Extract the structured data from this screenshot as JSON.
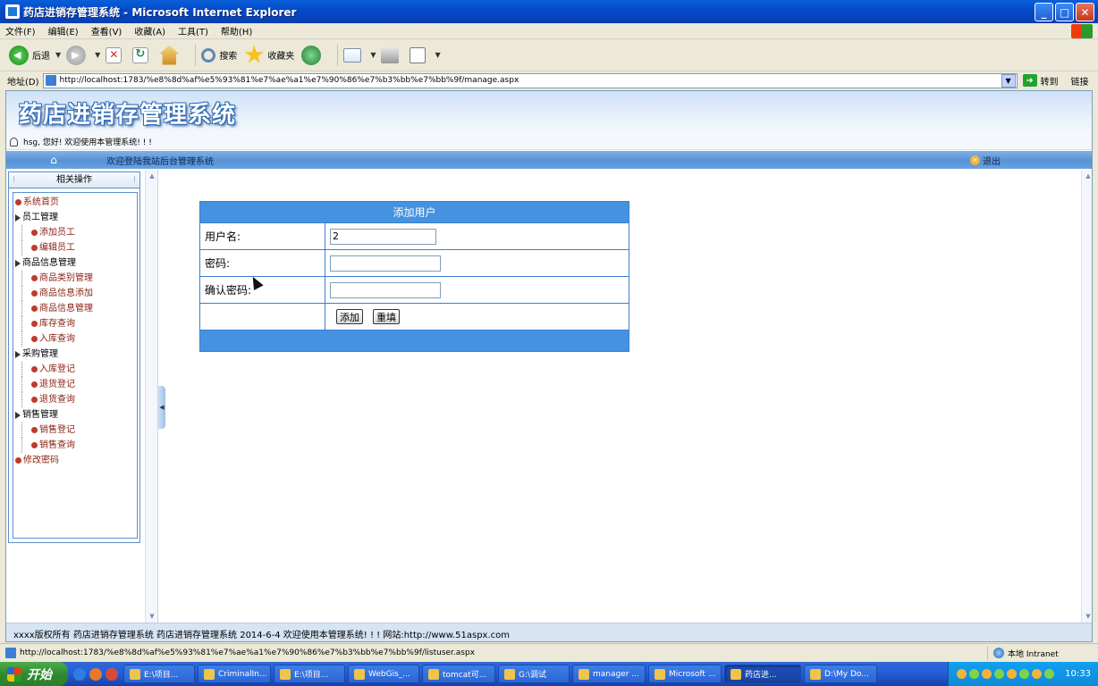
{
  "window": {
    "title": "药店进销存管理系统 - Microsoft Internet Explorer",
    "min": "_",
    "max": "□",
    "close": "✕"
  },
  "menubar": [
    "文件(F)",
    "编辑(E)",
    "查看(V)",
    "收藏(A)",
    "工具(T)",
    "帮助(H)"
  ],
  "toolbar": {
    "back": "后退",
    "search": "搜索",
    "favorites": "收藏夹"
  },
  "address": {
    "label": "地址(D)",
    "url": "http://localhost:1783/%e8%8d%af%e5%93%81%e7%ae%a1%e7%90%86%e7%b3%bb%e7%bb%9f/manage.aspx",
    "go": "转到",
    "links": "链接"
  },
  "site": {
    "logo": "药店进销存管理系统",
    "greeting": "hsg, 您好! 欢迎使用本管理系统! ! !",
    "nav_welcome": "欢迎登陆我站后台管理系统",
    "logout": "退出"
  },
  "sidebar": {
    "title": "相关操作",
    "items": [
      {
        "label": "系统首页",
        "level": "top"
      },
      {
        "label": "员工管理",
        "level": "group"
      },
      {
        "label": "添加员工",
        "level": "sub"
      },
      {
        "label": "编辑员工",
        "level": "sub"
      },
      {
        "label": "商品信息管理",
        "level": "group"
      },
      {
        "label": "商品类别管理",
        "level": "sub"
      },
      {
        "label": "商品信息添加",
        "level": "sub"
      },
      {
        "label": "商品信息管理",
        "level": "sub"
      },
      {
        "label": "库存查询",
        "level": "sub"
      },
      {
        "label": "入库查询",
        "level": "sub"
      },
      {
        "label": "采购管理",
        "level": "group"
      },
      {
        "label": "入库登记",
        "level": "sub"
      },
      {
        "label": "退货登记",
        "level": "sub"
      },
      {
        "label": "退货查询",
        "level": "sub"
      },
      {
        "label": "销售管理",
        "level": "group"
      },
      {
        "label": "销售登记",
        "level": "sub"
      },
      {
        "label": "销售查询",
        "level": "sub"
      },
      {
        "label": "修改密码",
        "level": "top"
      }
    ]
  },
  "form": {
    "title": "添加用户",
    "username_label": "用户名:",
    "username_value": "2",
    "password_label": "密码:",
    "password_value": "",
    "confirm_label": "确认密码:",
    "confirm_value": "",
    "add_button": "添加",
    "reset_button": "重填"
  },
  "footer": "xxxx版权所有  药店进销存管理系统   药店进销存管理系统  2014-6-4 欢迎使用本管理系统! ! !   网站:http://www.51aspx.com",
  "status": {
    "url": "http://localhost:1783/%e8%8d%af%e5%93%81%e7%ae%a1%e7%90%86%e7%b3%bb%e7%bb%9f/listuser.aspx",
    "zone": "本地 Intranet"
  },
  "taskbar": {
    "start": "开始",
    "tasks": [
      {
        "label": "E:\\项目..."
      },
      {
        "label": "CriminalIn..."
      },
      {
        "label": "E:\\项目..."
      },
      {
        "label": "WebGis_..."
      },
      {
        "label": "tomcat可..."
      },
      {
        "label": "G:\\调试"
      },
      {
        "label": "manager ..."
      },
      {
        "label": "Microsoft ..."
      },
      {
        "label": "药店进..."
      },
      {
        "label": "D:\\My Do..."
      }
    ],
    "active_index": 8,
    "clock": "10:33"
  }
}
